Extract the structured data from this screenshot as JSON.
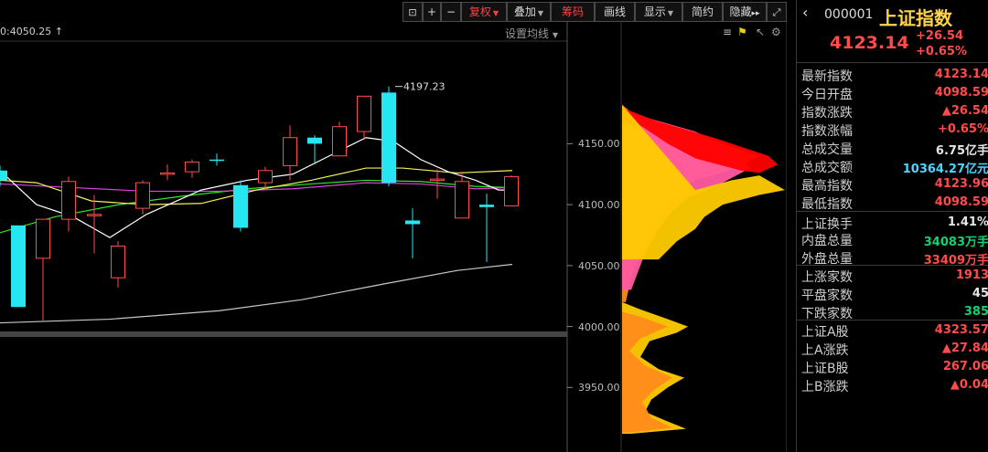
{
  "toolbar": {
    "lock_label": "🔓",
    "plus_label": "+",
    "minus_label": "−",
    "fq_label": "复权",
    "overlay_label": "叠加",
    "chips_label": "筹码",
    "draw_label": "画线",
    "display_label": "显示",
    "simple_label": "简约",
    "hide_label": "隐藏",
    "hide_arrows": "⏩",
    "fullscreen_icon": "expand-icon"
  },
  "chart": {
    "ma_readout": "0:4050.25",
    "ma_arrow": "↑",
    "settings_label": "设置均线",
    "high_annotation": "4197.23",
    "y_ticks": [
      "4150.00",
      "4100.00",
      "4050.00",
      "4000.00",
      "3950.00"
    ],
    "y_tick_values": [
      4150,
      4100,
      4050,
      4000,
      3950
    ],
    "colors": {
      "up": "#ff4d4d",
      "down": "#26e6f2",
      "ma5": "#ffffff",
      "ma10": "#f7f05a",
      "ma20": "#e040e0",
      "ma60": "#2ee82e",
      "ma250": "#c8c8c8"
    }
  },
  "chart_data": {
    "type": "candlestick",
    "ylim": [
      3915,
      4205
    ],
    "candles": [
      {
        "o": 4128,
        "h": 4132,
        "c": 4120,
        "l": 4115
      },
      {
        "o": 4083,
        "h": 4083,
        "c": 4016,
        "l": 4016
      },
      {
        "o": 4056,
        "h": 4072,
        "c": 4088,
        "l": 4005
      },
      {
        "o": 4088,
        "h": 4123,
        "c": 4119,
        "l": 4078
      },
      {
        "o": 4092,
        "h": 4108,
        "c": 4092,
        "l": 4060
      },
      {
        "o": 4040,
        "h": 4070,
        "c": 4066,
        "l": 4032
      },
      {
        "o": 4097,
        "h": 4120,
        "c": 4118,
        "l": 4092
      },
      {
        "o": 4125,
        "h": 4133,
        "c": 4126,
        "l": 4120
      },
      {
        "o": 4127,
        "h": 4137,
        "c": 4135,
        "l": 4122
      },
      {
        "o": 4137,
        "h": 4142,
        "c": 4136,
        "l": 4132
      },
      {
        "o": 4116,
        "h": 4120,
        "c": 4081,
        "l": 4078
      },
      {
        "o": 4118,
        "h": 4131,
        "c": 4128,
        "l": 4112
      },
      {
        "o": 4132,
        "h": 4165,
        "c": 4155,
        "l": 4120
      },
      {
        "o": 4155,
        "h": 4157,
        "c": 4150,
        "l": 4133
      },
      {
        "o": 4140,
        "h": 4168,
        "c": 4164,
        "l": 4140
      },
      {
        "o": 4160,
        "h": 4187,
        "c": 4189,
        "l": 4153
      },
      {
        "o": 4192,
        "h": 4197,
        "c": 4118,
        "l": 4115
      },
      {
        "o": 4087,
        "h": 4097,
        "c": 4084,
        "l": 4056
      },
      {
        "o": 4120,
        "h": 4129,
        "c": 4121,
        "l": 4105
      },
      {
        "o": 4089,
        "h": 4127,
        "c": 4119,
        "l": 4089
      },
      {
        "o": 4100,
        "h": 4109,
        "c": 4098,
        "l": 4053
      },
      {
        "o": 4099,
        "h": 4124,
        "c": 4123,
        "l": 4099
      }
    ]
  },
  "panel": {
    "code": "000001",
    "name": "上证指数",
    "price": "4123.14",
    "change": "+26.54",
    "change_pct": "+0.65%",
    "rows": [
      {
        "label": "最新指数",
        "value": "4123.14",
        "color": "red"
      },
      {
        "label": "今日开盘",
        "value": "4098.59",
        "color": "red"
      },
      {
        "label": "指数涨跌",
        "value": "▲26.54",
        "color": "red"
      },
      {
        "label": "指数涨幅",
        "value": "+0.65%",
        "color": "red"
      },
      {
        "label": "总成交量",
        "value": "6.75亿手",
        "color": "white"
      },
      {
        "label": "总成交额",
        "value": "10364.27亿元",
        "color": "cyan"
      },
      {
        "label": "最高指数",
        "value": "4123.96",
        "color": "red"
      },
      {
        "label": "最低指数",
        "value": "4098.59",
        "color": "red"
      },
      {
        "label": "上证换手",
        "value": "1.41%",
        "color": "white"
      },
      {
        "label": "内盘总量",
        "value": "34083万手",
        "color": "green"
      },
      {
        "label": "外盘总量",
        "value": "33409万手",
        "color": "red"
      },
      {
        "label": "上涨家数",
        "value": "1913",
        "color": "red"
      },
      {
        "label": "平盘家数",
        "value": "45",
        "color": "white"
      },
      {
        "label": "下跌家数",
        "value": "385",
        "color": "green"
      },
      {
        "label": "上证A股",
        "value": "4323.57",
        "color": "red"
      },
      {
        "label": "上A涨跌",
        "value": "▲27.84",
        "color": "red"
      },
      {
        "label": "上证B股",
        "value": "267.06",
        "color": "red"
      },
      {
        "label": "上B涨跌",
        "value": "▲0.04",
        "color": "red"
      }
    ]
  }
}
